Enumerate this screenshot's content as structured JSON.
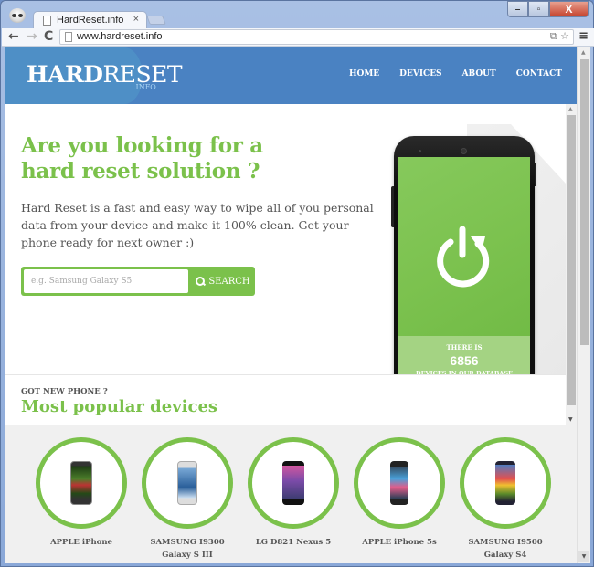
{
  "browser": {
    "tab_title": "HardReset.info",
    "tab_close": "×",
    "url": "www.hardreset.info",
    "nav": {
      "back": "←",
      "forward": "→",
      "reload": "C"
    },
    "omnibox_icons": "⧉ ☆",
    "menu": "≡",
    "window_controls": {
      "minimize": "–",
      "maximize": "▫",
      "close": "X"
    }
  },
  "site": {
    "logo": {
      "bold": "HARD",
      "regular": "RESET",
      "sub": ".INFO"
    },
    "nav": [
      {
        "label": "HOME"
      },
      {
        "label": "DEVICES"
      },
      {
        "label": "ABOUT"
      },
      {
        "label": "CONTACT"
      }
    ],
    "hero": {
      "title": "Are you looking for a hard reset solution ?",
      "description": "Hard Reset is a fast and easy way to wipe all of you personal data from your device and make it 100% clean. Get your phone ready for next owner :)",
      "search_placeholder": "e.g. Samsung Galaxy S5",
      "search_button": "SEARCH"
    },
    "counter": {
      "top": "THERE IS",
      "count": "6856",
      "bottom": "DEVICES IN OUR DATABASE"
    },
    "popular": {
      "kicker": "GOT NEW PHONE ?",
      "title": "Most popular devices",
      "devices": [
        {
          "name": "APPLE iPhone"
        },
        {
          "name": "SAMSUNG I9300 Galaxy S III"
        },
        {
          "name": "LG D821 Nexus 5"
        },
        {
          "name": "APPLE iPhone 5s"
        },
        {
          "name": "SAMSUNG I9500 Galaxy S4"
        }
      ]
    }
  },
  "scrollbars": {
    "arrow_up": "▲",
    "arrow_down": "▼"
  },
  "colors": {
    "brand_green": "#7bc14b",
    "header_blue": "#4a82c2"
  }
}
